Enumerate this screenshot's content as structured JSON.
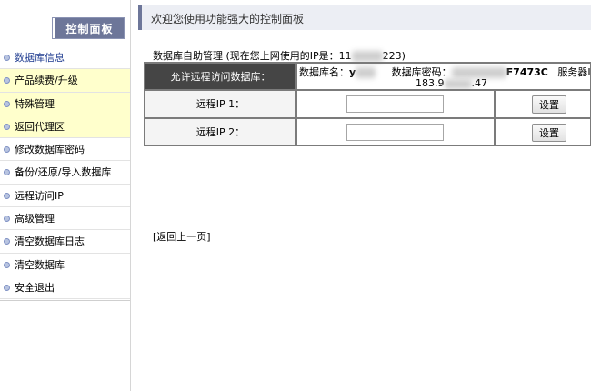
{
  "sidebar": {
    "title": "控制面板",
    "items": [
      {
        "label": "数据库信息",
        "active": true,
        "highlighted": false
      },
      {
        "label": "产品续费/升级",
        "active": false,
        "highlighted": true
      },
      {
        "label": "特殊管理",
        "active": false,
        "highlighted": true
      },
      {
        "label": "返回代理区",
        "active": false,
        "highlighted": true
      },
      {
        "label": "修改数据库密码",
        "active": false,
        "highlighted": false
      },
      {
        "label": "备份/还原/导入数据库",
        "active": false,
        "highlighted": false
      },
      {
        "label": "远程访问IP",
        "active": false,
        "highlighted": false
      },
      {
        "label": "高级管理",
        "active": false,
        "highlighted": false
      },
      {
        "label": "清空数据库日志",
        "active": false,
        "highlighted": false
      },
      {
        "label": "清空数据库",
        "active": false,
        "highlighted": false
      },
      {
        "label": "安全退出",
        "active": false,
        "highlighted": false
      }
    ]
  },
  "banner": {
    "title": "欢迎您使用功能强大的控制面板"
  },
  "info": {
    "prefix": "数据库自助管理 (现在您上网使用的IP是：11",
    "suffix": "223)"
  },
  "table": {
    "header": "允许远程访问数据库：",
    "db_name_label": "数据库名：",
    "db_name_value": "y",
    "db_pwd_label": "数据库密码：",
    "db_pwd_value": "F7473C",
    "server_label": "服务器IP",
    "server_ip_prefix": "183.9",
    "server_ip_suffix": ".47",
    "rows": [
      {
        "label": "远程IP 1：",
        "value": "",
        "button": "设置"
      },
      {
        "label": "远程IP 2：",
        "value": "",
        "button": "设置"
      }
    ]
  },
  "back_link": "[返回上一页]",
  "colors": {
    "accent": "#6d7699",
    "highlight_row": "#ffffcc",
    "table_header_bg": "#454545"
  }
}
